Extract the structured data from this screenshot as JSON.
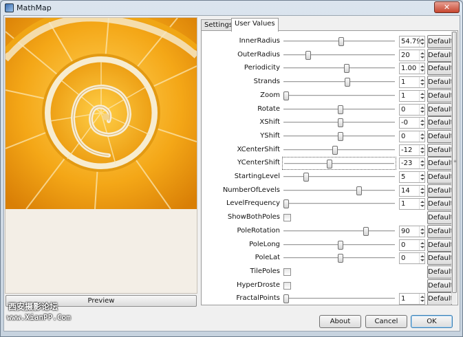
{
  "window": {
    "title": "MathMap",
    "close_glyph": "✕",
    "app_icon": "mathmap-app-icon"
  },
  "preview": {
    "button_label": "Preview",
    "image": "orange-slice-droste-spiral"
  },
  "tabs": [
    {
      "label": "Settings",
      "active": false
    },
    {
      "label": "User Values",
      "active": true
    }
  ],
  "params": [
    {
      "label": "InnerRadius",
      "type": "slider",
      "value": "54.79",
      "level": 0.52
    },
    {
      "label": "OuterRadius",
      "type": "slider",
      "value": "20",
      "level": 0.21
    },
    {
      "label": "Periodicity",
      "type": "slider",
      "value": "1.00",
      "level": 0.57
    },
    {
      "label": "Strands",
      "type": "slider",
      "value": "1",
      "level": 0.58
    },
    {
      "label": "Zoom",
      "type": "slider",
      "value": "1",
      "level": 0.0
    },
    {
      "label": "Rotate",
      "type": "slider",
      "value": "0",
      "level": 0.51
    },
    {
      "label": "XShift",
      "type": "slider",
      "value": "-0",
      "level": 0.51
    },
    {
      "label": "YShift",
      "type": "slider",
      "value": "0",
      "level": 0.51
    },
    {
      "label": "XCenterShift",
      "type": "slider",
      "value": "-12",
      "level": 0.46
    },
    {
      "label": "YCenterShift",
      "type": "slider",
      "value": "-23",
      "level": 0.4,
      "focused": true
    },
    {
      "label": "StartingLevel",
      "type": "slider",
      "value": "5",
      "level": 0.19
    },
    {
      "label": "NumberOfLevels",
      "type": "slider",
      "value": "14",
      "level": 0.69
    },
    {
      "label": "LevelFrequency",
      "type": "slider",
      "value": "1",
      "level": 0.0
    },
    {
      "label": "ShowBothPoles",
      "type": "checkbox",
      "checked": false
    },
    {
      "label": "PoleRotation",
      "type": "slider",
      "value": "90",
      "level": 0.75
    },
    {
      "label": "PoleLong",
      "type": "slider",
      "value": "0",
      "level": 0.51
    },
    {
      "label": "PoleLat",
      "type": "slider",
      "value": "0",
      "level": 0.51
    },
    {
      "label": "TilePoles",
      "type": "checkbox",
      "checked": false
    },
    {
      "label": "HyperDroste",
      "type": "checkbox",
      "checked": false
    },
    {
      "label": "FractalPoints",
      "type": "slider",
      "value": "1",
      "level": 0.0
    }
  ],
  "default_label": "Default",
  "buttons": {
    "about": "About",
    "cancel": "Cancel",
    "ok": "OK"
  },
  "watermark": {
    "line1": "西安摄影论坛",
    "line2": "www.XianPP.Com"
  },
  "colors": {
    "orange": "#f3a51a",
    "pith": "#f6ead2",
    "window_frame": "#c7d3df",
    "close_red": "#c7462f"
  }
}
